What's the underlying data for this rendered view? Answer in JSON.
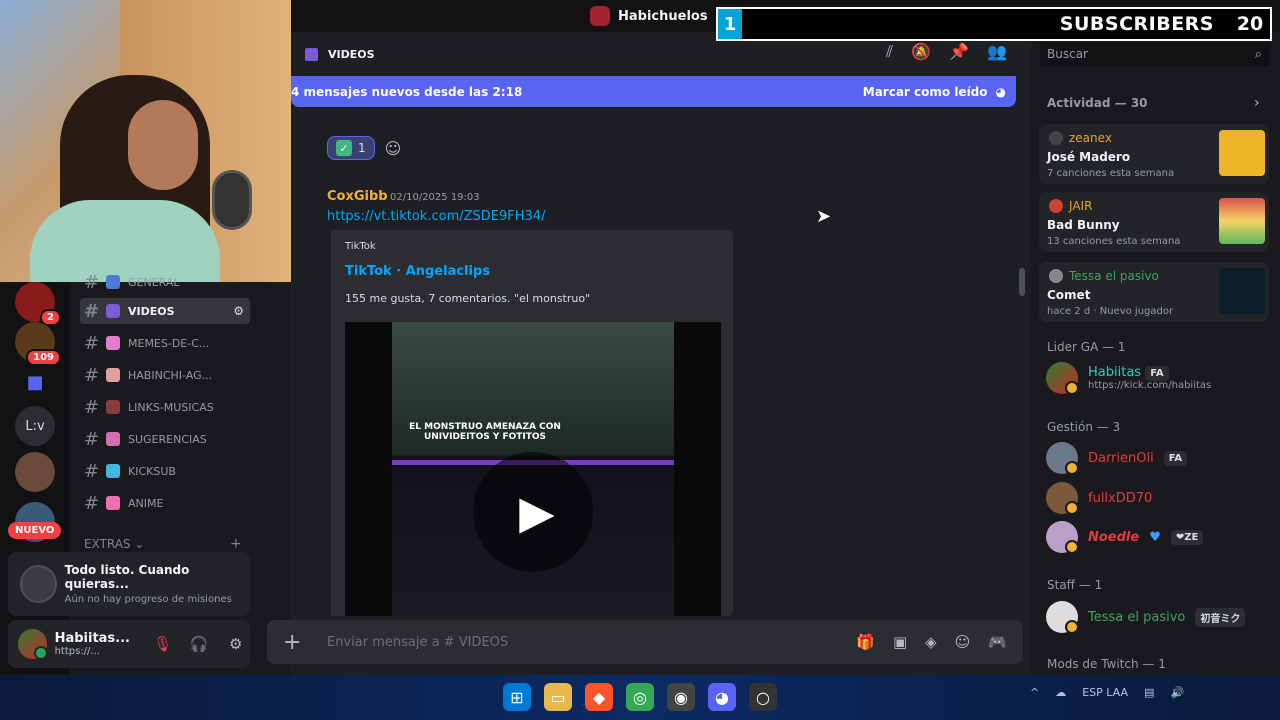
{
  "window": {
    "server_name": "Habichuelos"
  },
  "overlay": {
    "left_number": "1",
    "label": "SUBSCRIBERS",
    "count": "20"
  },
  "rail": {
    "badges": [
      "2",
      "109"
    ],
    "text_item": "L:v",
    "new_label": "NUEVO"
  },
  "channels": {
    "items": [
      {
        "label": "GENERAL",
        "emoji_color": "#4e7bd6"
      },
      {
        "label": "VIDEOS",
        "emoji_color": "#7b5bd6",
        "active": true
      },
      {
        "label": "MEMES-DE-C...",
        "emoji_color": "#e27cd1"
      },
      {
        "label": "HABINCHI-AG...",
        "emoji_color": "#e0a0a0"
      },
      {
        "label": "LINKS-MUSICAS",
        "emoji_color": "#8a3b3b"
      },
      {
        "label": "SUGERENCIAS",
        "emoji_color": "#d56fb0"
      },
      {
        "label": "KICKSUB",
        "emoji_color": "#3fb9e0"
      },
      {
        "label": "ANIME",
        "emoji_color": "#f06fb3"
      }
    ],
    "category": "EXTRAS"
  },
  "quest": {
    "title": "Todo listo. Cuando quieras...",
    "subtitle": "Aún no hay progreso de misiones"
  },
  "user": {
    "name": "Habiitas...",
    "status": "https://..."
  },
  "header": {
    "channel": "VIDEOS",
    "search_placeholder": "Buscar"
  },
  "new_messages": {
    "text": "4 mensajes nuevos desde las 2:18",
    "action": "Marcar como leído"
  },
  "reaction": {
    "count": "1"
  },
  "message": {
    "author": "CoxGibb",
    "timestamp": "02/10/2025 19:03",
    "link": "https://vt.tiktok.com/ZSDE9FH34/",
    "embed": {
      "provider": "TikTok",
      "title": "TikTok · Angelaclips",
      "description": "155 me gusta, 7 comentarios. \"el monstruo\"",
      "video_caption": "EL MONSTRUO AMENAZA CON UNIVIDEITOS Y FOTITOS"
    }
  },
  "composer": {
    "placeholder": "Enviar mensaje a #",
    "channel": "VIDEOS"
  },
  "activity": {
    "header": "Actividad — 30",
    "cards": [
      {
        "user": "zeanex",
        "user_color": "#e8a035",
        "title": "José Madero",
        "sub": "7 canciones esta semana"
      },
      {
        "user": "JAIR",
        "user_color": "#e8a035",
        "title": "Bad Bunny",
        "sub": "13 canciones esta semana"
      },
      {
        "user": "Tessa el pasivo",
        "user_color": "#3ba55c",
        "title": "Comet",
        "sub": "hace 2 d",
        "sub2": "Nuevo jugador"
      }
    ]
  },
  "members": {
    "groups": [
      {
        "header": "Lider GA — 1",
        "members": [
          {
            "name": "Habiitas",
            "color": "#1fd1c4",
            "tag": "FA",
            "status": "https://kick.com/habiitas"
          }
        ]
      },
      {
        "header": "Gestión — 3",
        "members": [
          {
            "name": "DarrienOli",
            "color": "#e23b3b",
            "tag": "FA"
          },
          {
            "name": "fullxDD70",
            "color": "#e23b3b"
          },
          {
            "name": "Noedle",
            "color": "#e23b3b",
            "tag": "❤ZE"
          }
        ]
      },
      {
        "header": "Staff — 1",
        "members": [
          {
            "name": "Tessa el pasivo",
            "color": "#3ba55c",
            "tag": "初音ミク"
          }
        ]
      },
      {
        "header": "Mods de Twitch — 1",
        "members": []
      }
    ]
  },
  "taskbar": {
    "lang": "ESP LAA"
  }
}
